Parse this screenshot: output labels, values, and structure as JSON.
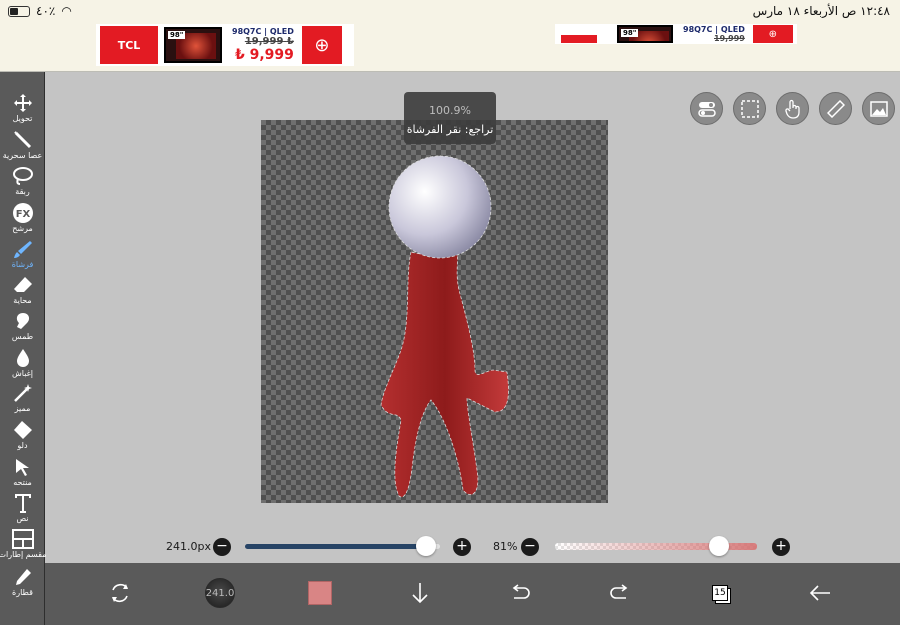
{
  "status_bar": {
    "time_date": "١٢:٤٨ ص  الأربعاء ١٨ مارس",
    "battery": "٤٠٪"
  },
  "ads": [
    {
      "brand": "TCL",
      "badge": "98\"",
      "model": "98Q7C | QLED",
      "old_price": "19,999",
      "new_price": "9,999",
      "currency": "₺"
    },
    {
      "brand": "",
      "badge": "98\"",
      "model": "98Q7C | QLED",
      "old_price": "19,999",
      "new_price": "",
      "currency": ""
    }
  ],
  "tools": [
    {
      "name": "move",
      "label": "تحويل",
      "icon": "move-icon"
    },
    {
      "name": "magic-wand",
      "label": "عصا سحرية",
      "icon": "magic-wand-icon"
    },
    {
      "name": "lasso",
      "label": "ربقة",
      "icon": "lasso-icon"
    },
    {
      "name": "filter",
      "label": "مرشح",
      "icon": "fx-icon"
    },
    {
      "name": "brush",
      "label": "فرشاة",
      "icon": "brush-icon",
      "active": true
    },
    {
      "name": "eraser",
      "label": "محاية",
      "icon": "eraser-icon"
    },
    {
      "name": "smudge",
      "label": "طمس",
      "icon": "smudge-icon"
    },
    {
      "name": "blur",
      "label": "إغباش",
      "icon": "drop-icon"
    },
    {
      "name": "special",
      "label": "مميز",
      "icon": "sparkle-icon"
    },
    {
      "name": "fill",
      "label": "دلو",
      "icon": "bucket-icon"
    },
    {
      "name": "select",
      "label": "منتحه",
      "icon": "arrow-icon"
    },
    {
      "name": "text",
      "label": "نص",
      "icon": "text-icon"
    },
    {
      "name": "frame",
      "label": "مقسم إطارات",
      "icon": "frame-icon"
    },
    {
      "name": "eyedropper",
      "label": "قطارة",
      "icon": "eyedropper-icon"
    }
  ],
  "zoom_tooltip": {
    "zoom": "100.9%",
    "undo_text": "تراجع: نقر الفرشاة"
  },
  "brush": {
    "size_label": "241.0px",
    "size_fraction": 0.93,
    "opacity_label": "81%",
    "opacity_fraction": 0.81
  },
  "bottom_bar": {
    "brush_size": "241.0",
    "layer_count": "15",
    "color": "#d98585"
  },
  "colors": {
    "toolbar_bg": "#5a5a5a",
    "canvas_bg": "#c4c4c4",
    "accent": "#6fb6ff",
    "size_track": "#274466"
  }
}
